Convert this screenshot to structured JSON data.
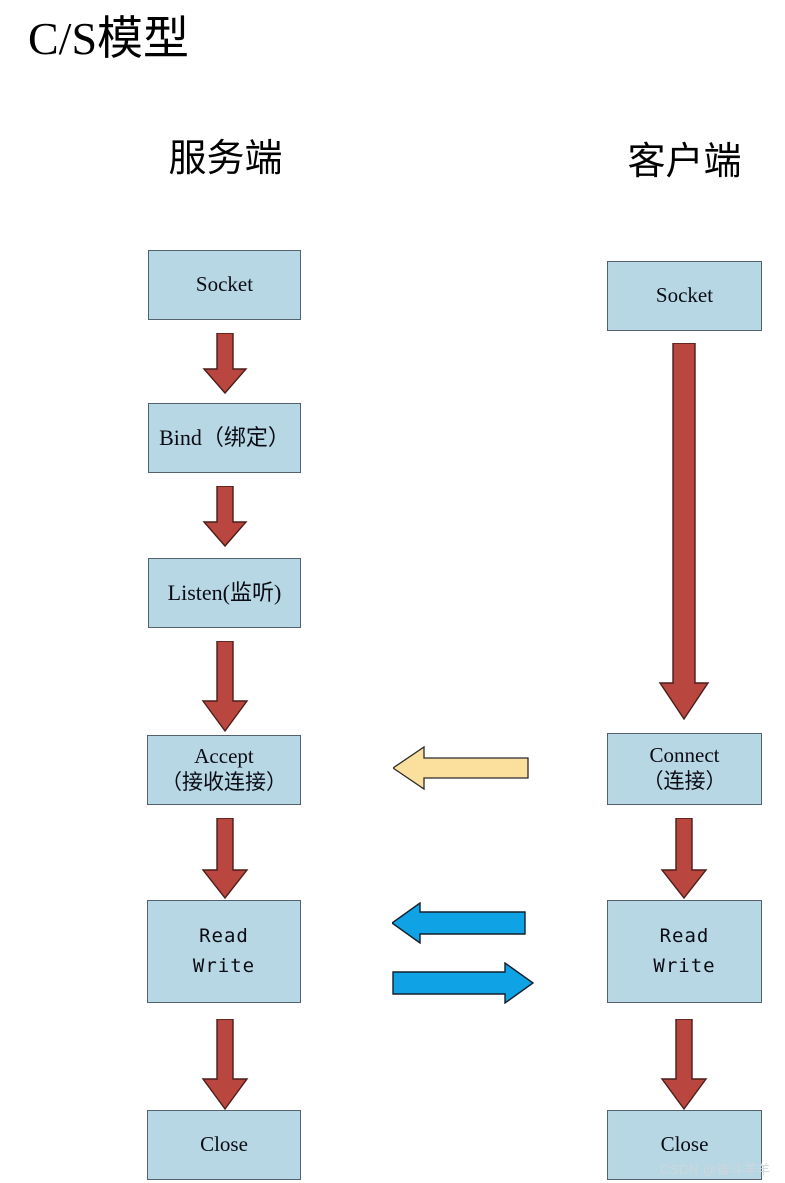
{
  "page": {
    "title": "C/S模型",
    "background_color": "#ffffff",
    "watermark": "CSDN @奋斗羊羊"
  },
  "colors": {
    "box_fill": "#b6d7e3",
    "box_border": "#53626c",
    "red_arrow_fill": "#b9473f",
    "red_arrow_border": "#4a1d19",
    "yellow_arrow_fill": "#fadf9d",
    "yellow_arrow_border": "#2b2b2b",
    "blue_arrow_fill": "#0fa3e6",
    "blue_arrow_border": "#14202b",
    "text_color": "#0b0b14",
    "watermark_color": "#cfd6dc"
  },
  "columns": {
    "server": {
      "header": "服务端",
      "nodes": [
        {
          "id": "server-socket",
          "label": "Socket",
          "sub": ""
        },
        {
          "id": "server-bind",
          "label": "Bind（绑定）",
          "sub": ""
        },
        {
          "id": "server-listen",
          "label": "Listen(监听)",
          "sub": ""
        },
        {
          "id": "server-accept",
          "label": "Accept",
          "sub": "（接收连接）"
        },
        {
          "id": "server-rw",
          "label": "Read",
          "sub": "Write"
        },
        {
          "id": "server-close",
          "label": "Close",
          "sub": ""
        }
      ]
    },
    "client": {
      "header": "客户端",
      "nodes": [
        {
          "id": "client-socket",
          "label": "Socket",
          "sub": ""
        },
        {
          "id": "client-connect",
          "label": "Connect",
          "sub": "（连接）"
        },
        {
          "id": "client-rw",
          "label": "Read",
          "sub": "Write"
        },
        {
          "id": "client-close",
          "label": "Close",
          "sub": ""
        }
      ]
    }
  },
  "arrows": {
    "server_flow": [
      {
        "id": "arrow-server-socket-to-bind",
        "direction": "down",
        "color": "#b9473f"
      },
      {
        "id": "arrow-server-bind-to-listen",
        "direction": "down",
        "color": "#b9473f"
      },
      {
        "id": "arrow-server-listen-to-accept",
        "direction": "down",
        "color": "#b9473f"
      },
      {
        "id": "arrow-server-accept-to-rw",
        "direction": "down",
        "color": "#b9473f"
      },
      {
        "id": "arrow-server-rw-to-close",
        "direction": "down",
        "color": "#b9473f"
      }
    ],
    "client_flow": [
      {
        "id": "arrow-client-socket-to-connect",
        "direction": "down",
        "color": "#b9473f"
      },
      {
        "id": "arrow-client-connect-to-rw",
        "direction": "down",
        "color": "#b9473f"
      },
      {
        "id": "arrow-client-rw-to-close",
        "direction": "down",
        "color": "#b9473f"
      }
    ],
    "cross": [
      {
        "id": "arrow-connect-to-accept",
        "direction": "left",
        "color": "#fadf9d",
        "meaning": "connect request"
      },
      {
        "id": "arrow-client-to-server-data",
        "direction": "left",
        "color": "#0fa3e6",
        "meaning": "client writes / server reads"
      },
      {
        "id": "arrow-server-to-client-data",
        "direction": "right",
        "color": "#0fa3e6",
        "meaning": "server writes / client reads"
      }
    ]
  },
  "chart_data": {
    "type": "diagram",
    "title": "C/S模型",
    "description": "Client/Server socket API call sequence flowchart",
    "lanes": [
      "服务端",
      "客户端"
    ],
    "server_sequence": [
      "Socket",
      "Bind（绑定）",
      "Listen(监听)",
      "Accept（接收连接）",
      "Read Write",
      "Close"
    ],
    "client_sequence": [
      "Socket",
      "Connect（连接）",
      "Read Write",
      "Close"
    ],
    "cross_links": [
      {
        "from": "Connect（连接）",
        "to": "Accept（接收连接）",
        "color": "#fadf9d"
      },
      {
        "from": "Read Write (客户端)",
        "to": "Read Write (服务端)",
        "color": "#0fa3e6"
      },
      {
        "from": "Read Write (服务端)",
        "to": "Read Write (客户端)",
        "color": "#0fa3e6"
      }
    ]
  }
}
